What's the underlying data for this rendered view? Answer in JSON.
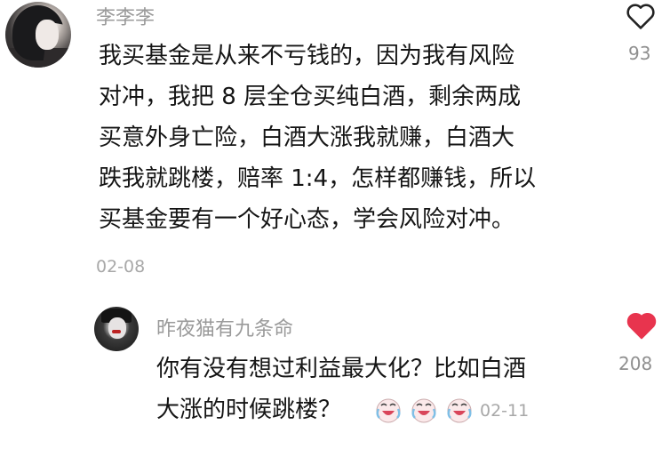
{
  "comments": [
    {
      "username": "李李李",
      "text_lines": [
        "我买基金是从来不亏钱的，因为我有风险",
        "对冲，我把 8 层全仓买纯白酒，剩余两成",
        "买意外身亡险，白酒大涨我就赚，白酒大",
        "跌我就跳楼，赔率 1:4，怎样都赚钱，所以",
        "买基金要有一个好心态，学会风险对冲。"
      ],
      "date": "02-08",
      "like_count": "93",
      "liked": false
    }
  ],
  "reply": {
    "username": "昨夜猫有九条命",
    "text_lines": [
      "你有没有想过利益最大化？比如白酒",
      "大涨的时候跳楼？"
    ],
    "emoji_icon": "crying-laughing-face-icon",
    "emoji_count": 3,
    "date": "02-11",
    "like_count": "208",
    "liked": true
  },
  "colors": {
    "liked_heart": "#e8344e",
    "meta_gray": "#9a9a9a"
  }
}
